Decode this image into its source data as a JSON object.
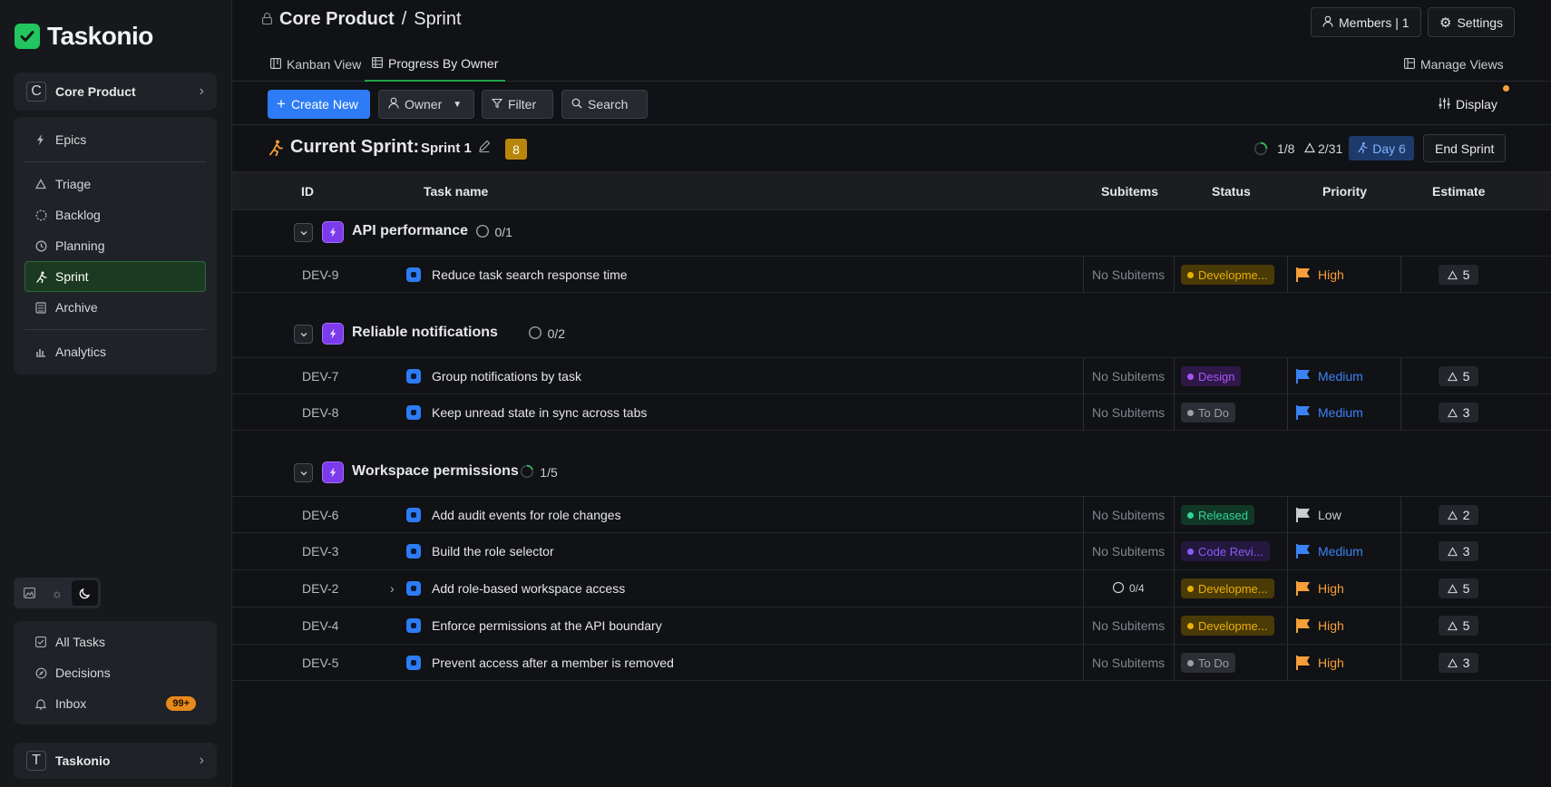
{
  "app": {
    "name": "Taskonio"
  },
  "sidebar": {
    "workspace": {
      "avatar": "C",
      "name": "Core Product"
    },
    "nav": [
      {
        "label": "Epics",
        "icon": "bolt-icon"
      },
      {
        "label": "Triage",
        "icon": "triangle-icon"
      },
      {
        "label": "Backlog",
        "icon": "dashed-circle-icon"
      },
      {
        "label": "Planning",
        "icon": "clock-icon"
      },
      {
        "label": "Sprint",
        "icon": "runner-icon",
        "active": true
      },
      {
        "label": "Archive",
        "icon": "archive-icon"
      },
      {
        "label": "Analytics",
        "icon": "bar-chart-icon"
      }
    ],
    "bottom_nav": [
      {
        "label": "All Tasks",
        "icon": "checkbox-icon"
      },
      {
        "label": "Decisions",
        "icon": "compass-icon"
      },
      {
        "label": "Inbox",
        "icon": "bell-icon",
        "badge": "99+"
      }
    ],
    "org": {
      "avatar": "T",
      "name": "Taskonio"
    }
  },
  "header": {
    "project": "Core Product",
    "separator": "/",
    "page": "Sprint",
    "members_label": "Members | 1",
    "settings_label": "Settings"
  },
  "views": {
    "tabs": [
      {
        "label": "Kanban View"
      },
      {
        "label": "Progress By Owner",
        "active": true
      }
    ],
    "manage_label": "Manage Views"
  },
  "toolbar": {
    "create_label": "Create New",
    "owner_label": "Owner",
    "filter_label": "Filter",
    "search_label": "Search",
    "display_label": "Display"
  },
  "sprint": {
    "heading": "Current Sprint:",
    "name": "Sprint 1",
    "count": "8",
    "progress": "1/8",
    "points": "2/31",
    "day": "Day 6",
    "end_label": "End Sprint"
  },
  "table": {
    "columns": {
      "id": "ID",
      "task": "Task name",
      "subitems": "Subitems",
      "status": "Status",
      "priority": "Priority",
      "estimate": "Estimate"
    },
    "groups": [
      {
        "name": "API performance",
        "progress": "0/1",
        "tasks": [
          {
            "id": "DEV-9",
            "name": "Reduce task search response time",
            "subitems": "No Subitems",
            "status": "Developme...",
            "priority": "High",
            "estimate": "5"
          }
        ]
      },
      {
        "name": "Reliable notifications",
        "progress": "0/2",
        "tasks": [
          {
            "id": "DEV-7",
            "name": "Group notifications by task",
            "subitems": "No Subitems",
            "status": "Design",
            "priority": "Medium",
            "estimate": "5"
          },
          {
            "id": "DEV-8",
            "name": "Keep unread state in sync across tabs",
            "subitems": "No Subitems",
            "status": "To Do",
            "priority": "Medium",
            "estimate": "3"
          }
        ]
      },
      {
        "name": "Workspace permissions",
        "progress": "1/5",
        "tasks": [
          {
            "id": "DEV-6",
            "name": "Add audit events for role changes",
            "subitems": "No Subitems",
            "status": "Released",
            "priority": "Low",
            "estimate": "2"
          },
          {
            "id": "DEV-3",
            "name": "Build the role selector",
            "subitems": "No Subitems",
            "status": "Code Revi...",
            "priority": "Medium",
            "estimate": "3"
          },
          {
            "id": "DEV-2",
            "name": "Add role-based workspace access",
            "subitems": "0/4",
            "status": "Developme...",
            "priority": "High",
            "estimate": "5"
          },
          {
            "id": "DEV-4",
            "name": "Enforce permissions at the API boundary",
            "subitems": "No Subitems",
            "status": "Developme...",
            "priority": "High",
            "estimate": "5"
          },
          {
            "id": "DEV-5",
            "name": "Prevent access after a member is removed",
            "subitems": "No Subitems",
            "status": "To Do",
            "priority": "High",
            "estimate": "3"
          }
        ]
      }
    ]
  },
  "colors": {
    "accent_green": "#22c55e",
    "primary_blue": "#2d7cf6",
    "high": "#f59f3a",
    "medium": "#3b82f6",
    "low": "#c8cbd0",
    "status_development": "#e8b007",
    "status_design": "#a855f7",
    "status_todo": "#9aa0aa",
    "status_released": "#34d399",
    "status_code_review": "#8b5cf6"
  }
}
